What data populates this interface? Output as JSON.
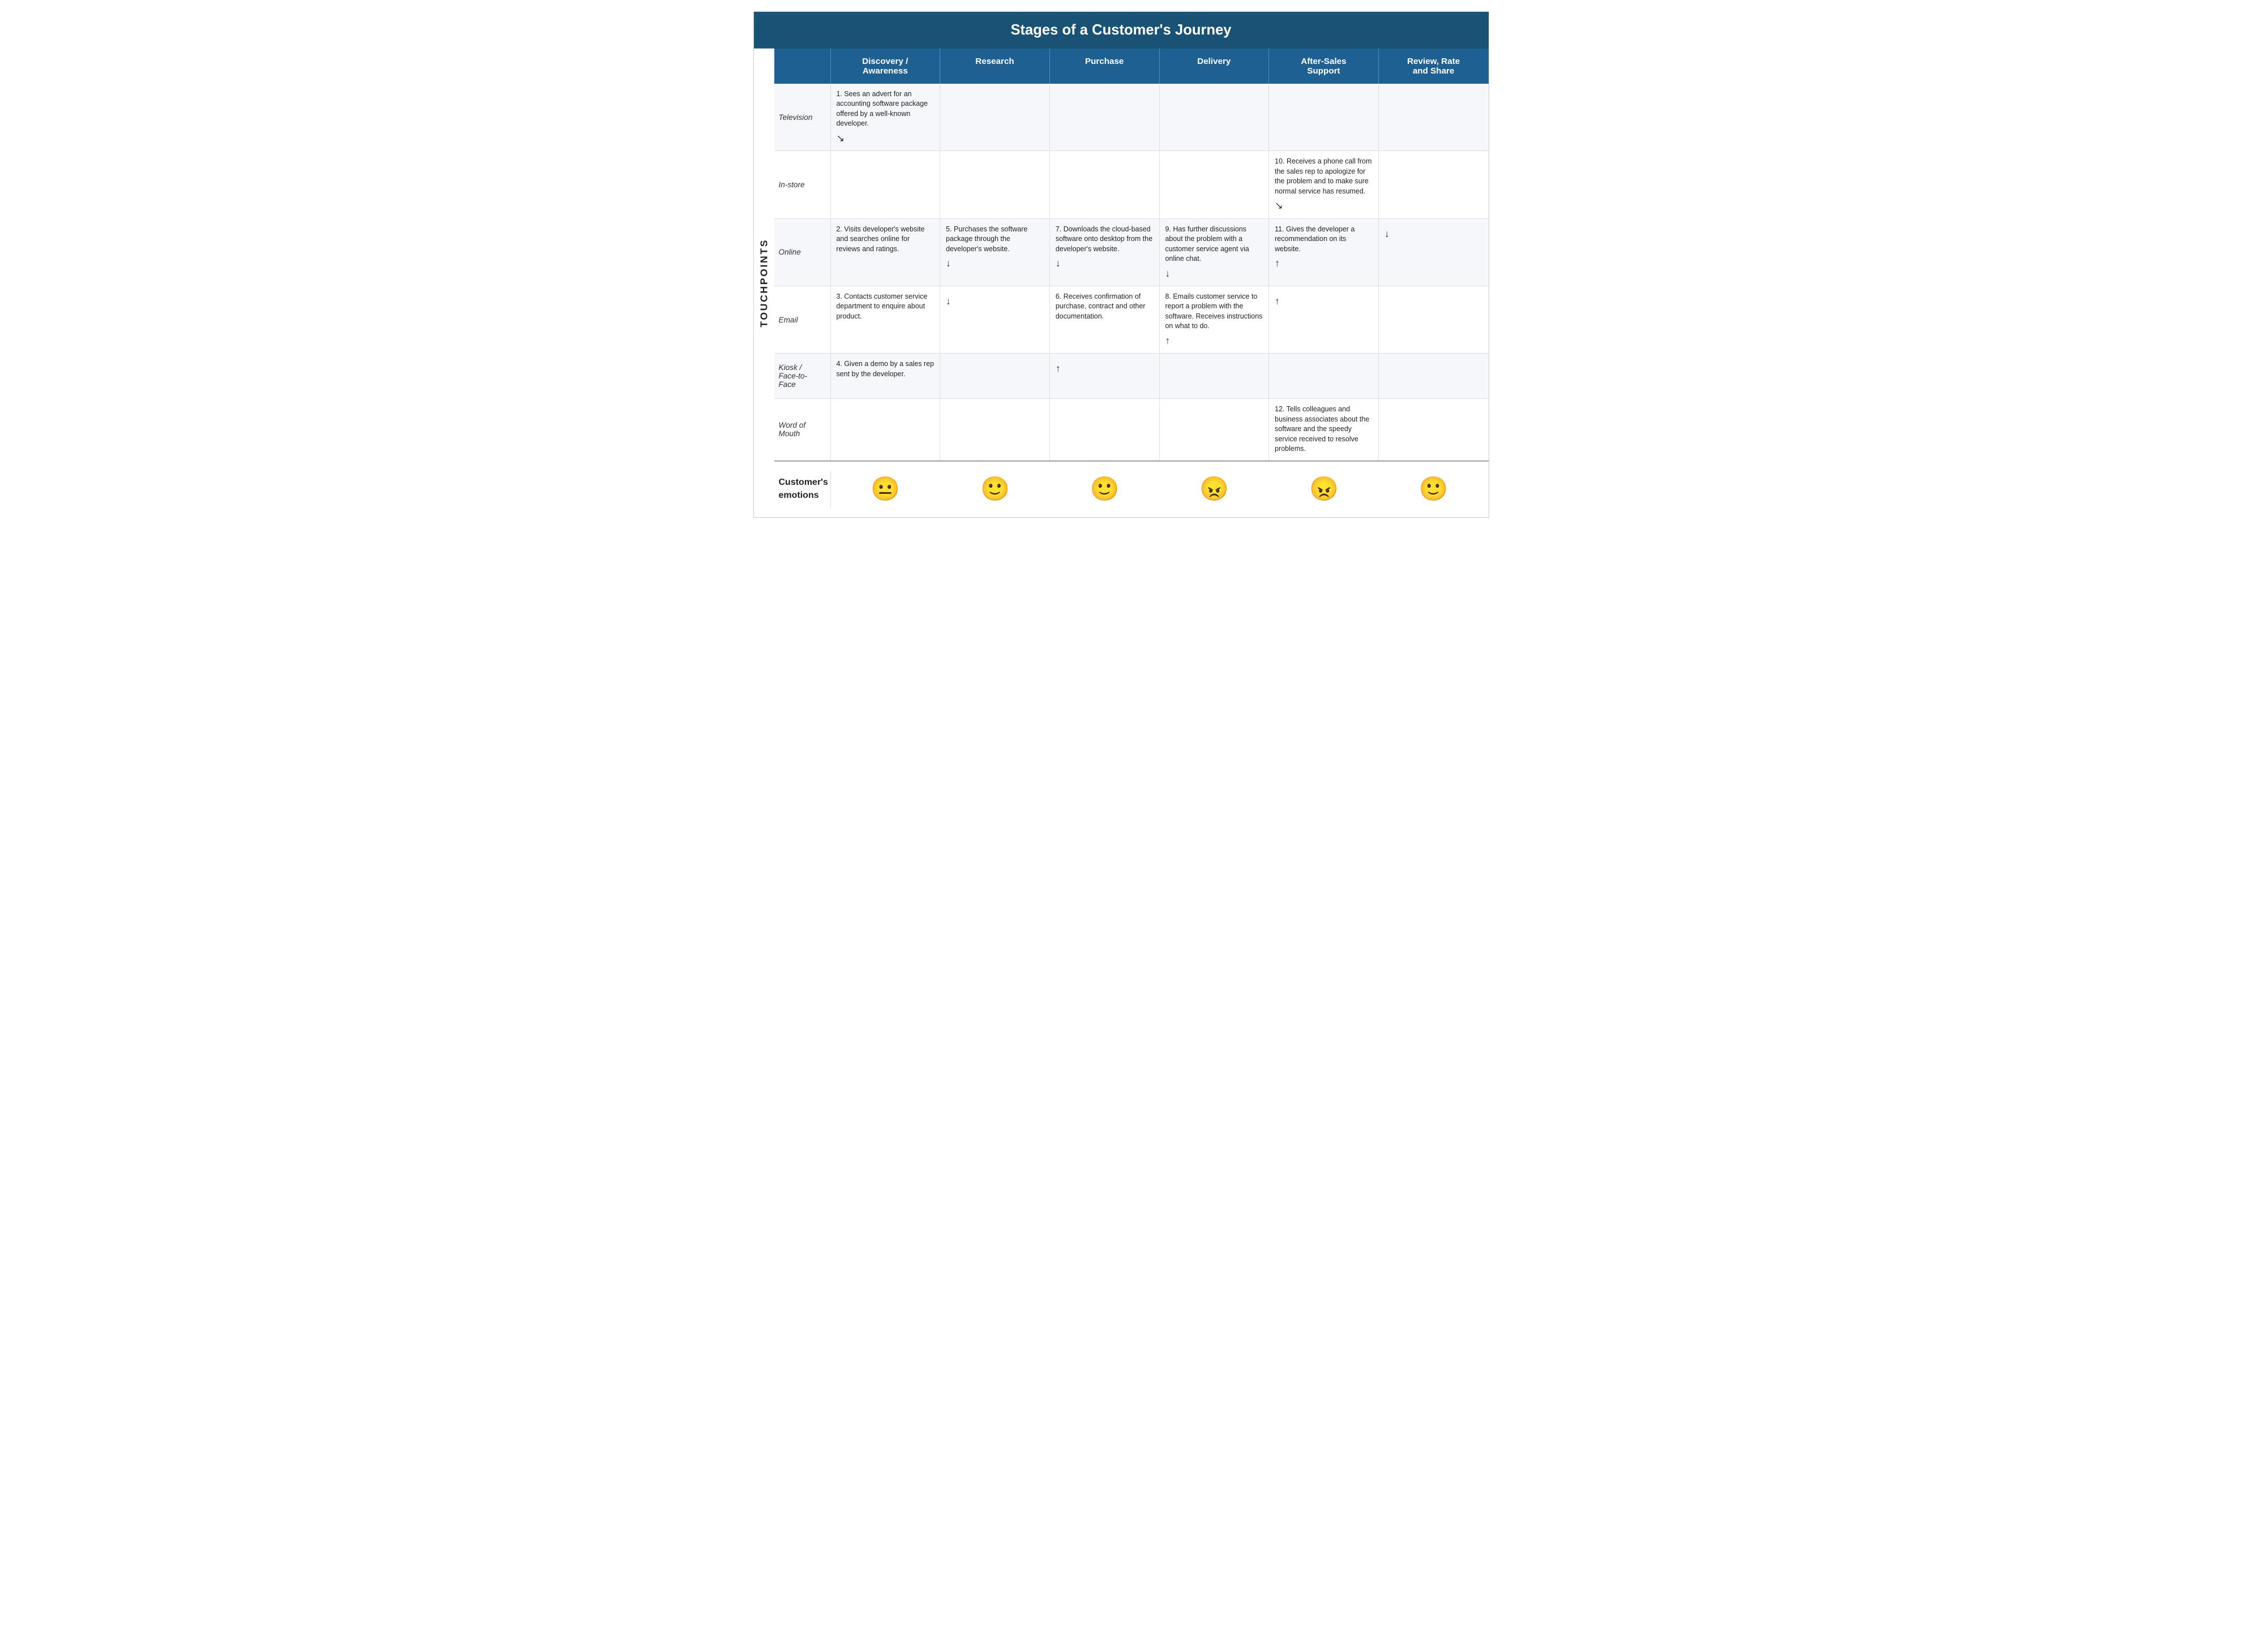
{
  "title": "Stages of a Customer's Journey",
  "touchpoints_label": "TOUCHPOINTS",
  "header": {
    "blank": "",
    "col1": "Discovery /\nAwareness",
    "col2": "Research",
    "col3": "Purchase",
    "col4": "Delivery",
    "col5": "After-Sales\nSupport",
    "col6": "Review, Rate\nand Share"
  },
  "rows": [
    {
      "label": "Television",
      "cells": [
        "1. Sees an advert for an accounting software package offered by a well-known developer.",
        "",
        "",
        "",
        "",
        ""
      ]
    },
    {
      "label": "In-store",
      "cells": [
        "",
        "",
        "",
        "",
        "10. Receives a phone call from the sales rep to apologize for the problem and to make sure normal service has resumed.",
        ""
      ]
    },
    {
      "label": "Online",
      "cells": [
        "2. Visits developer's website and searches online for reviews and ratings.",
        "5. Purchases the software package through the developer's website.",
        "7. Downloads the cloud-based software onto desktop from the developer's website.",
        "9. Has further discussions about the problem with a customer service agent via online chat.",
        "11. Gives the developer a recommendation on its website.",
        ""
      ]
    },
    {
      "label": "Email",
      "cells": [
        "3. Contacts customer service department to enquire about product.",
        "",
        "6. Receives confirmation of purchase, contract and other documentation.",
        "8. Emails customer service to report a problem with the software. Receives instructions on what to do.",
        "",
        ""
      ]
    },
    {
      "label": "Kiosk /\nFace-to-\nFace",
      "cells": [
        "4. Given a demo by a sales rep sent by the developer.",
        "",
        "",
        "",
        "",
        ""
      ]
    },
    {
      "label": "Word of\nMouth",
      "cells": [
        "",
        "",
        "",
        "",
        "12. Tells colleagues and business associates about the software and the speedy service received to resolve problems.",
        ""
      ]
    }
  ],
  "emotions": {
    "label": "Customer's\nemotions",
    "items": [
      "😐",
      "🙂",
      "🙂",
      "😠",
      "😠",
      "🙂"
    ]
  }
}
